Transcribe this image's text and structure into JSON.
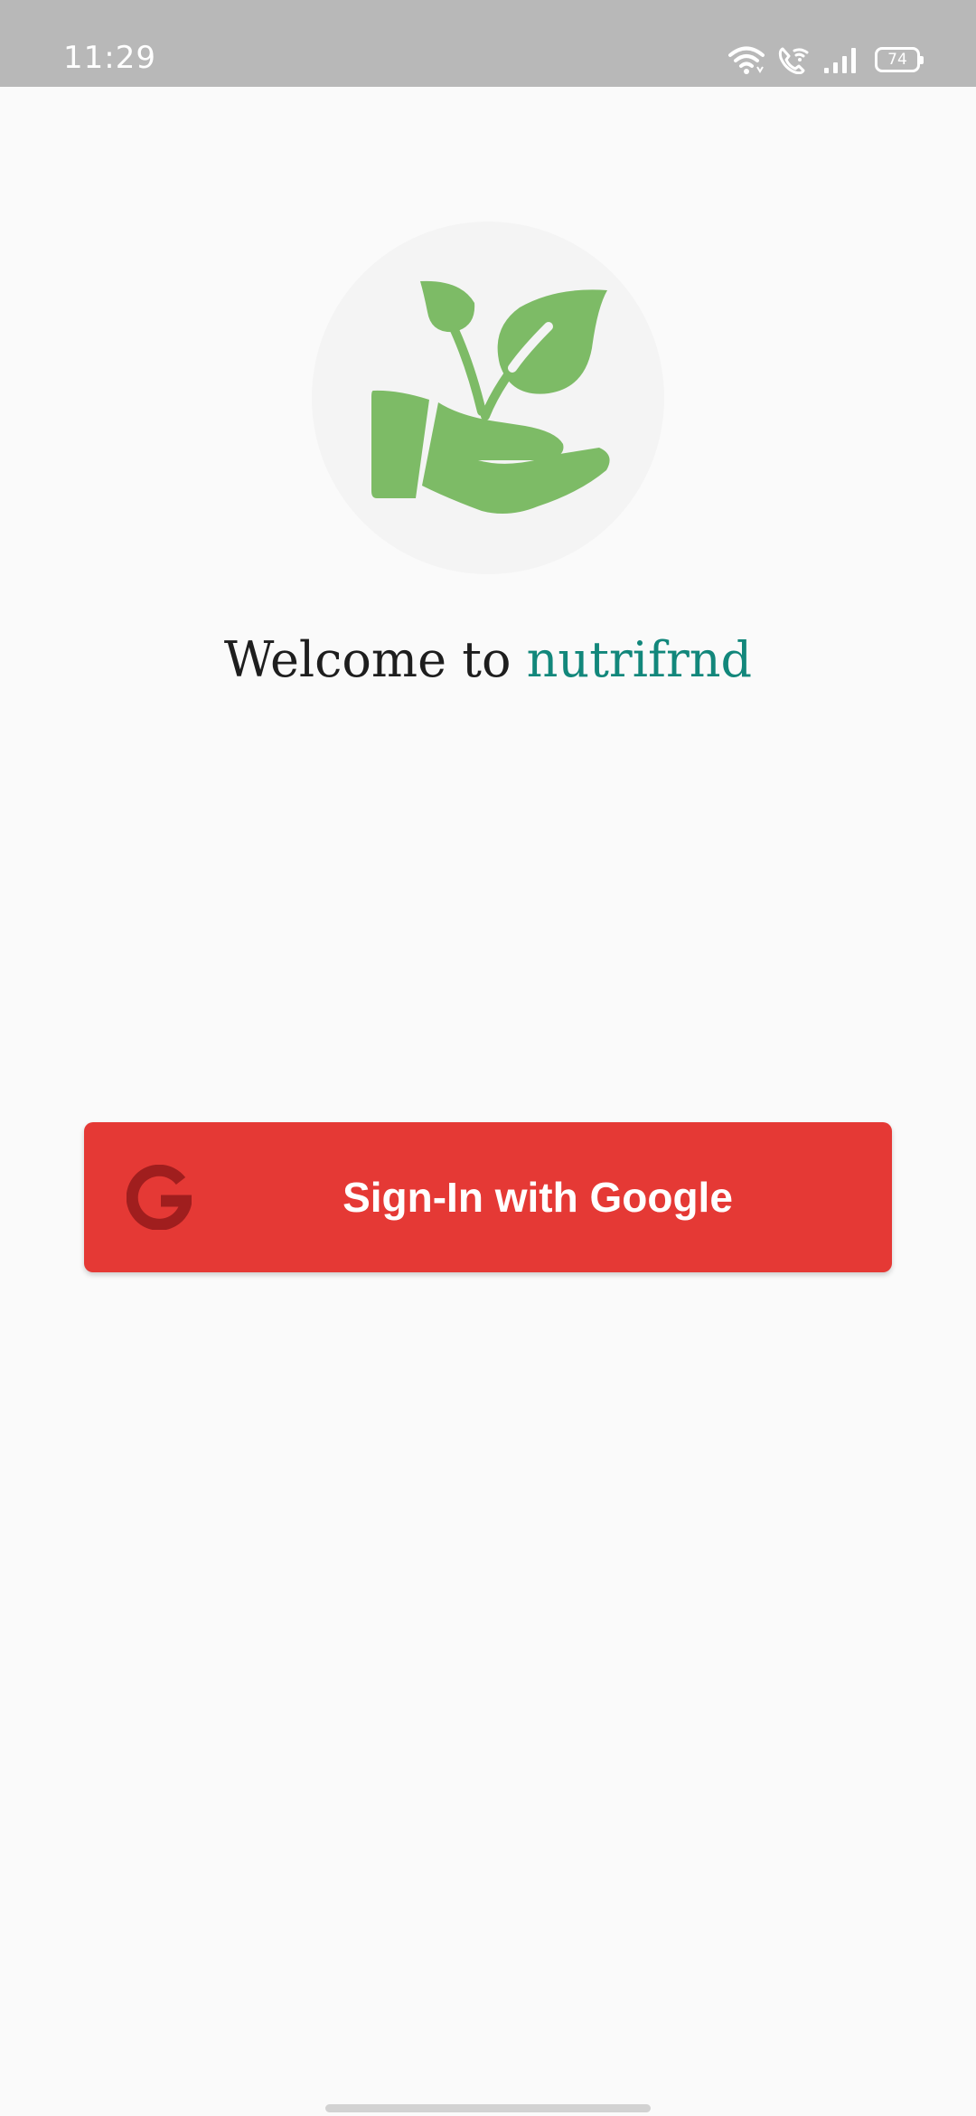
{
  "status_bar": {
    "time": "11:29",
    "icons": [
      "wifi-icon",
      "wifi-calling-icon",
      "cell-signal-icon",
      "battery-icon"
    ],
    "battery_level": "74"
  },
  "logo": {
    "icon": "plant-in-hand-icon",
    "color": "#7dbb66"
  },
  "welcome": {
    "prefix": "Welcome to",
    "brand": "nutrifrnd",
    "brand_color": "#12877b"
  },
  "sign_in": {
    "label": "Sign-In with Google",
    "icon": "google-icon",
    "background": "#e53935",
    "icon_color": "#a01e1e"
  }
}
